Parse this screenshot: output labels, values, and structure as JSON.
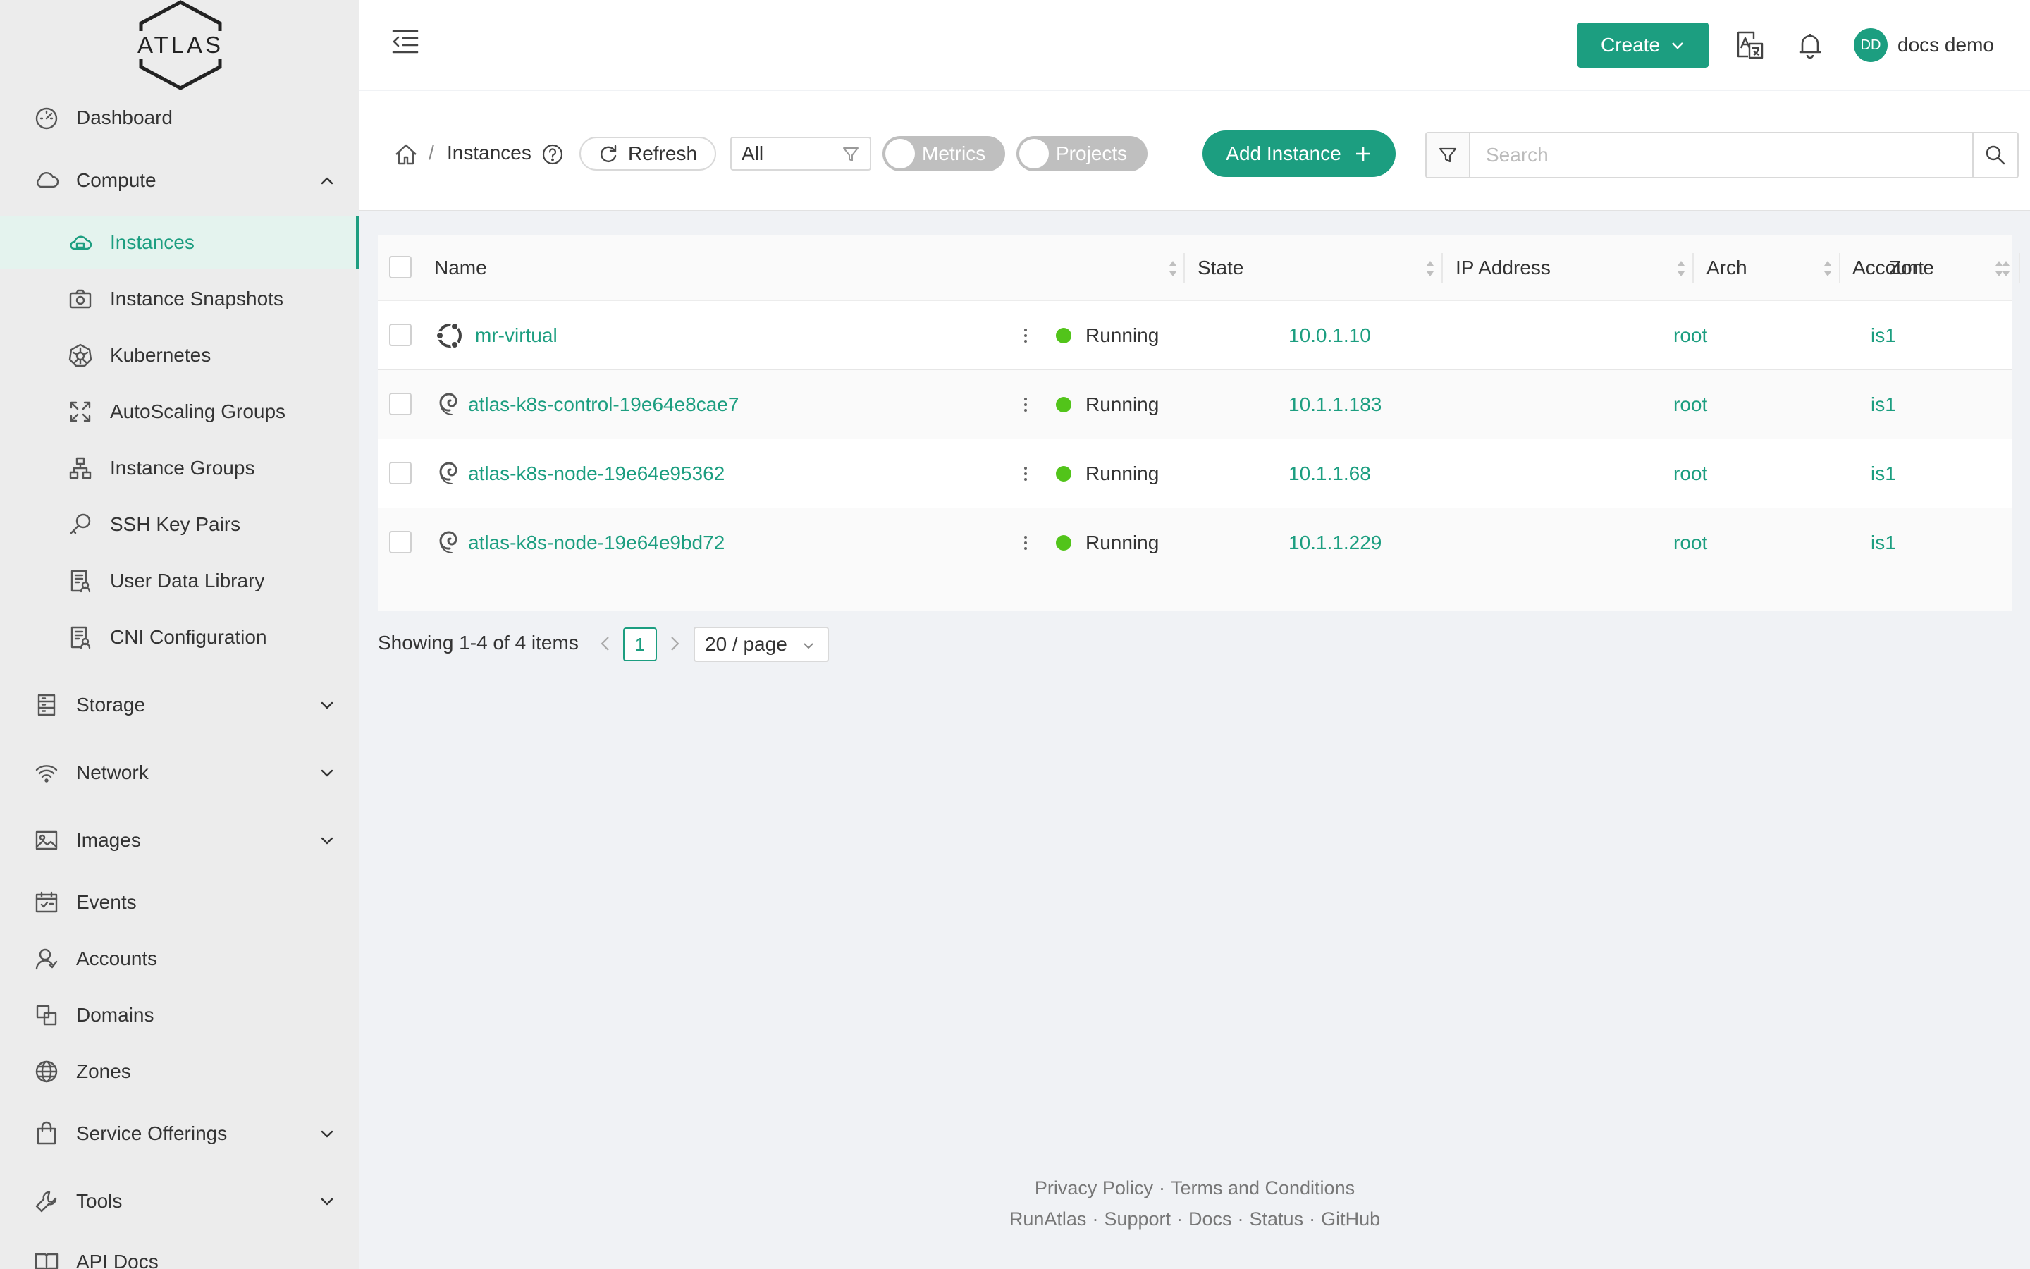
{
  "app": {
    "logo_text": "ATLAS"
  },
  "sidebar": {
    "items": [
      {
        "label": "Dashboard",
        "icon": "dashboard-icon"
      },
      {
        "label": "Compute",
        "icon": "cloud-icon",
        "expanded": true
      },
      {
        "label": "Instances",
        "icon": "cloud-instance-icon",
        "active": true
      },
      {
        "label": "Instance Snapshots",
        "icon": "camera-icon"
      },
      {
        "label": "Kubernetes",
        "icon": "kubernetes-icon"
      },
      {
        "label": "AutoScaling Groups",
        "icon": "expand-arrows-icon"
      },
      {
        "label": "Instance Groups",
        "icon": "cluster-icon"
      },
      {
        "label": "SSH Key Pairs",
        "icon": "key-icon"
      },
      {
        "label": "User Data Library",
        "icon": "document-user-icon"
      },
      {
        "label": "CNI Configuration",
        "icon": "document-user-icon"
      },
      {
        "label": "Storage",
        "icon": "storage-icon"
      },
      {
        "label": "Network",
        "icon": "wifi-icon"
      },
      {
        "label": "Images",
        "icon": "picture-icon"
      },
      {
        "label": "Events",
        "icon": "calendar-icon"
      },
      {
        "label": "Accounts",
        "icon": "user-icon"
      },
      {
        "label": "Domains",
        "icon": "block-icon"
      },
      {
        "label": "Zones",
        "icon": "globe-icon"
      },
      {
        "label": "Service Offerings",
        "icon": "shopping-bag-icon"
      },
      {
        "label": "Tools",
        "icon": "tool-icon"
      },
      {
        "label": "API Docs",
        "icon": "read-icon"
      }
    ]
  },
  "header": {
    "create_label": "Create",
    "user_initials": "DD",
    "user_name": "docs demo"
  },
  "toolbar": {
    "breadcrumb_current": "Instances",
    "breadcrumb_sep": "/",
    "refresh_label": "Refresh",
    "filter_value": "All",
    "metrics_label": "Metrics",
    "projects_label": "Projects",
    "add_label": "Add Instance",
    "search_placeholder": "Search"
  },
  "table": {
    "columns": [
      "Name",
      "State",
      "IP Address",
      "Arch",
      "Account",
      "Zone"
    ],
    "rows": [
      {
        "name": "mr-virtual",
        "os_icon": "ubuntu-icon",
        "state": "Running",
        "ip": "10.0.1.10",
        "arch": "",
        "account": "root",
        "zone": "is1"
      },
      {
        "name": "atlas-k8s-control-19e64e8cae7",
        "os_icon": "debian-icon",
        "state": "Running",
        "ip": "10.1.1.183",
        "arch": "",
        "account": "root",
        "zone": "is1"
      },
      {
        "name": "atlas-k8s-node-19e64e95362",
        "os_icon": "debian-icon",
        "state": "Running",
        "ip": "10.1.1.68",
        "arch": "",
        "account": "root",
        "zone": "is1"
      },
      {
        "name": "atlas-k8s-node-19e64e9bd72",
        "os_icon": "debian-icon",
        "state": "Running",
        "ip": "10.1.1.229",
        "arch": "",
        "account": "root",
        "zone": "is1"
      }
    ]
  },
  "pagination": {
    "total_text": "Showing 1-4 of 4 items",
    "current_page": "1",
    "page_size": "20 / page"
  },
  "footer": {
    "line1": [
      "Privacy Policy",
      "Terms and Conditions"
    ],
    "line2": [
      "RunAtlas",
      "Support",
      "Docs",
      "Status",
      "GitHub"
    ],
    "separator": "·"
  },
  "colors": {
    "accent": "#1c9e80",
    "running": "#52c41a",
    "sidebar_bg": "#ececec",
    "page_bg": "#f0f2f5"
  }
}
